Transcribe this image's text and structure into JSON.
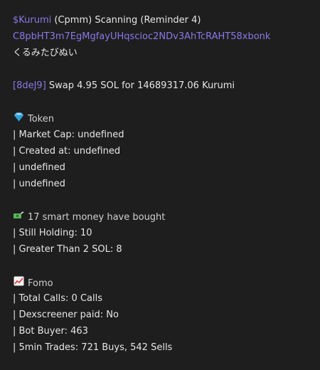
{
  "header": {
    "ticker": "$Kurumi",
    "title_rest": " (Cpmm) Scanning (Reminder 4)",
    "contract": "C8pbHT3m7EgMgfayUHqscioc2NDv3AhTcRAHT58xbonk",
    "name_jp": "くるみたびぬい"
  },
  "swap": {
    "wallet": "[8deJ9]",
    "text": " Swap 4.95 SOL for 14689317.06 Kurumi"
  },
  "token": {
    "icon": "gem-icon",
    "title": "Token",
    "lines": [
      "| Market Cap: undefined",
      "| Created at: undefined",
      "| undefined",
      "| undefined"
    ]
  },
  "smart_money": {
    "icon": "money-wings-icon",
    "title": "17 smart money have bought",
    "lines": [
      "| Still Holding: 10",
      "| Greater Than 2 SOL: 8"
    ]
  },
  "fomo": {
    "icon": "chart-increasing-icon",
    "title": "Fomo",
    "lines": [
      "| Total Calls: 0 Calls",
      "| Dexscreener paid: No",
      "| Bot Buyer: 463",
      "| 5min Trades: 721 Buys, 542 Sells"
    ]
  },
  "colors": {
    "background": "#1e1e1e",
    "link": "#8b78e6",
    "text": "#e6e6e6"
  }
}
